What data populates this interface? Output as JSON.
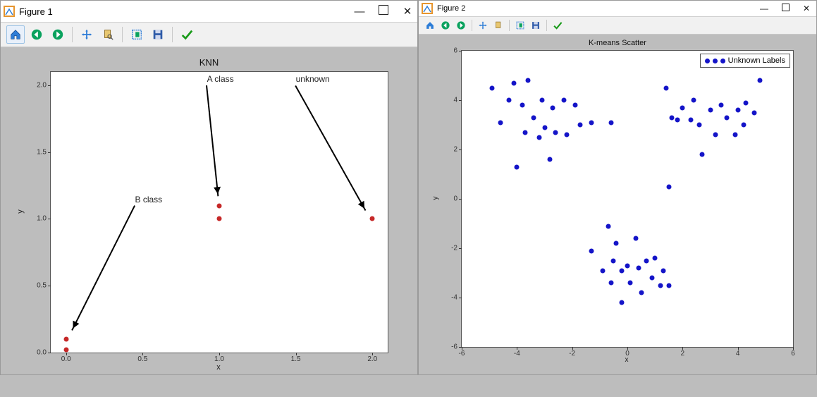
{
  "win1": {
    "title": "Figure 1"
  },
  "win2": {
    "title": "Figure 2"
  },
  "toolbar_icons": [
    "home",
    "back",
    "forward",
    "pan",
    "zoom",
    "config",
    "save",
    "check"
  ],
  "chart_data": [
    {
      "type": "scatter",
      "title": "KNN",
      "xlabel": "x",
      "ylabel": "y",
      "xlim": [
        -0.1,
        2.1
      ],
      "ylim": [
        0.0,
        2.1
      ],
      "xticks": [
        0.0,
        0.5,
        1.0,
        1.5,
        2.0
      ],
      "yticks": [
        0.0,
        0.5,
        1.0,
        1.5,
        2.0
      ],
      "points": [
        {
          "x": 0.0,
          "y": 0.1
        },
        {
          "x": 0.0,
          "y": 0.02
        },
        {
          "x": 1.0,
          "y": 1.0
        },
        {
          "x": 1.0,
          "y": 1.1
        },
        {
          "x": 2.0,
          "y": 1.0
        }
      ],
      "annotations": [
        {
          "text": "A class",
          "xy": [
            1.0,
            1.12
          ],
          "xytext": [
            0.92,
            2.0
          ]
        },
        {
          "text": "B class",
          "xy": [
            0.02,
            0.12
          ],
          "xytext": [
            0.45,
            1.1
          ]
        },
        {
          "text": "unknown",
          "xy": [
            1.98,
            1.02
          ],
          "xytext": [
            1.5,
            2.0
          ]
        }
      ]
    },
    {
      "type": "scatter",
      "title": "K-means Scatter",
      "xlabel": "x",
      "ylabel": "y",
      "xlim": [
        -6,
        6
      ],
      "ylim": [
        -6,
        6
      ],
      "xticks": [
        -6,
        -4,
        -2,
        0,
        2,
        4,
        6
      ],
      "yticks": [
        -6,
        -4,
        -2,
        0,
        2,
        4,
        6
      ],
      "legend": [
        "Unknown Labels"
      ],
      "points": [
        {
          "x": -4.9,
          "y": 4.5
        },
        {
          "x": -4.6,
          "y": 3.1
        },
        {
          "x": -4.3,
          "y": 4.0
        },
        {
          "x": -4.1,
          "y": 4.7
        },
        {
          "x": -4.0,
          "y": 1.3
        },
        {
          "x": -3.8,
          "y": 3.8
        },
        {
          "x": -3.7,
          "y": 2.7
        },
        {
          "x": -3.6,
          "y": 4.8
        },
        {
          "x": -3.4,
          "y": 3.3
        },
        {
          "x": -3.2,
          "y": 2.5
        },
        {
          "x": -3.1,
          "y": 4.0
        },
        {
          "x": -3.0,
          "y": 2.9
        },
        {
          "x": -2.8,
          "y": 1.6
        },
        {
          "x": -2.7,
          "y": 3.7
        },
        {
          "x": -2.6,
          "y": 2.7
        },
        {
          "x": -2.3,
          "y": 4.0
        },
        {
          "x": -2.2,
          "y": 2.6
        },
        {
          "x": -1.9,
          "y": 3.8
        },
        {
          "x": -1.7,
          "y": 3.0
        },
        {
          "x": -1.3,
          "y": 3.1
        },
        {
          "x": -0.6,
          "y": 3.1
        },
        {
          "x": 1.4,
          "y": 4.5
        },
        {
          "x": 1.6,
          "y": 3.3
        },
        {
          "x": 1.8,
          "y": 3.2
        },
        {
          "x": 2.0,
          "y": 3.7
        },
        {
          "x": 2.3,
          "y": 3.2
        },
        {
          "x": 2.4,
          "y": 4.0
        },
        {
          "x": 2.6,
          "y": 3.0
        },
        {
          "x": 2.7,
          "y": 1.8
        },
        {
          "x": 3.0,
          "y": 3.6
        },
        {
          "x": 3.2,
          "y": 2.6
        },
        {
          "x": 3.4,
          "y": 3.8
        },
        {
          "x": 3.6,
          "y": 3.3
        },
        {
          "x": 3.9,
          "y": 2.6
        },
        {
          "x": 4.0,
          "y": 3.6
        },
        {
          "x": 4.2,
          "y": 3.0
        },
        {
          "x": 4.3,
          "y": 3.9
        },
        {
          "x": 4.6,
          "y": 3.5
        },
        {
          "x": 4.8,
          "y": 4.8
        },
        {
          "x": 1.5,
          "y": 0.5
        },
        {
          "x": -1.3,
          "y": -2.1
        },
        {
          "x": -0.9,
          "y": -2.9
        },
        {
          "x": -0.7,
          "y": -1.1
        },
        {
          "x": -0.6,
          "y": -3.4
        },
        {
          "x": -0.5,
          "y": -2.5
        },
        {
          "x": -0.4,
          "y": -1.8
        },
        {
          "x": -0.2,
          "y": -2.9
        },
        {
          "x": -0.2,
          "y": -4.2
        },
        {
          "x": 0.0,
          "y": -2.7
        },
        {
          "x": 0.1,
          "y": -3.4
        },
        {
          "x": 0.3,
          "y": -1.6
        },
        {
          "x": 0.4,
          "y": -2.8
        },
        {
          "x": 0.5,
          "y": -3.8
        },
        {
          "x": 0.7,
          "y": -2.5
        },
        {
          "x": 0.9,
          "y": -3.2
        },
        {
          "x": 1.0,
          "y": -2.4
        },
        {
          "x": 1.2,
          "y": -3.5
        },
        {
          "x": 1.3,
          "y": -2.9
        },
        {
          "x": 1.5,
          "y": -3.5
        }
      ]
    }
  ]
}
